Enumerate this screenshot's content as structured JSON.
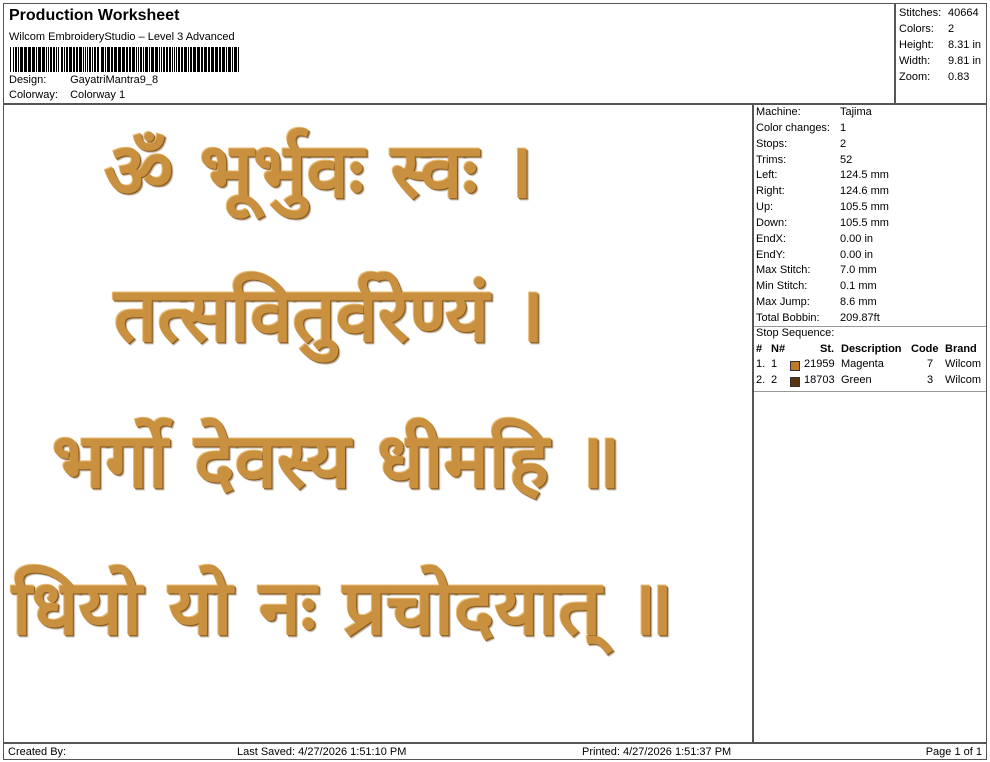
{
  "header": {
    "title": "Production Worksheet",
    "subtitle": "Wilcom EmbroideryStudio – Level 3 Advanced",
    "design_label": "Design:",
    "design_value": "GayatriMantra9_8",
    "colorway_label": "Colorway:",
    "colorway_value": "Colorway 1"
  },
  "stats": [
    {
      "label": "Stitches:",
      "value": "40664"
    },
    {
      "label": "Colors:",
      "value": "2"
    },
    {
      "label": "Height:",
      "value": "8.31 in"
    },
    {
      "label": "Width:",
      "value": "9.81 in"
    },
    {
      "label": "Zoom:",
      "value": "0.83"
    }
  ],
  "design": {
    "lines": [
      "ॐ भूर्भुवः स्वः ।",
      "तत्सवितुर्वरेण्यं ।",
      "भर्गो देवस्य धीमहि ॥",
      "धियो यो नः प्रचोदयात् ॥"
    ],
    "thread_color": "#c8903f"
  },
  "machine": [
    {
      "label": "Machine:",
      "value": "Tajima"
    },
    {
      "label": "Color changes:",
      "value": "1"
    },
    {
      "label": "Stops:",
      "value": "2"
    },
    {
      "label": "Trims:",
      "value": "52"
    },
    {
      "label": "Left:",
      "value": "124.5 mm"
    },
    {
      "label": "Right:",
      "value": "124.6 mm"
    },
    {
      "label": "Up:",
      "value": "105.5 mm"
    },
    {
      "label": "Down:",
      "value": "105.5 mm"
    },
    {
      "label": "EndX:",
      "value": "0.00 in"
    },
    {
      "label": "EndY:",
      "value": "0.00 in"
    },
    {
      "label": "Max Stitch:",
      "value": "7.0 mm"
    },
    {
      "label": "Min Stitch:",
      "value": "0.1 mm"
    },
    {
      "label": "Max Jump:",
      "value": "8.6 mm"
    },
    {
      "label": "Total Bobbin:",
      "value": "209.87ft"
    }
  ],
  "stop_sequence": {
    "title": "Stop Sequence:",
    "columns": {
      "num": "#",
      "n": "N#",
      "st": "St.",
      "description": "Description",
      "code": "Code",
      "brand": "Brand"
    },
    "rows": [
      {
        "num": "1.",
        "n": "1",
        "color": "#c07a2a",
        "st": "21959",
        "description": "Magenta",
        "code": "7",
        "brand": "Wilcom"
      },
      {
        "num": "2.",
        "n": "2",
        "color": "#5a3510",
        "st": "18703",
        "description": "Green",
        "code": "3",
        "brand": "Wilcom"
      }
    ]
  },
  "footer": {
    "created_by": "Created By:",
    "last_saved": "Last Saved: 4/27/2026 1:51:10 PM",
    "printed": "Printed: 4/27/2026 1:51:37 PM",
    "page": "Page 1 of 1"
  }
}
